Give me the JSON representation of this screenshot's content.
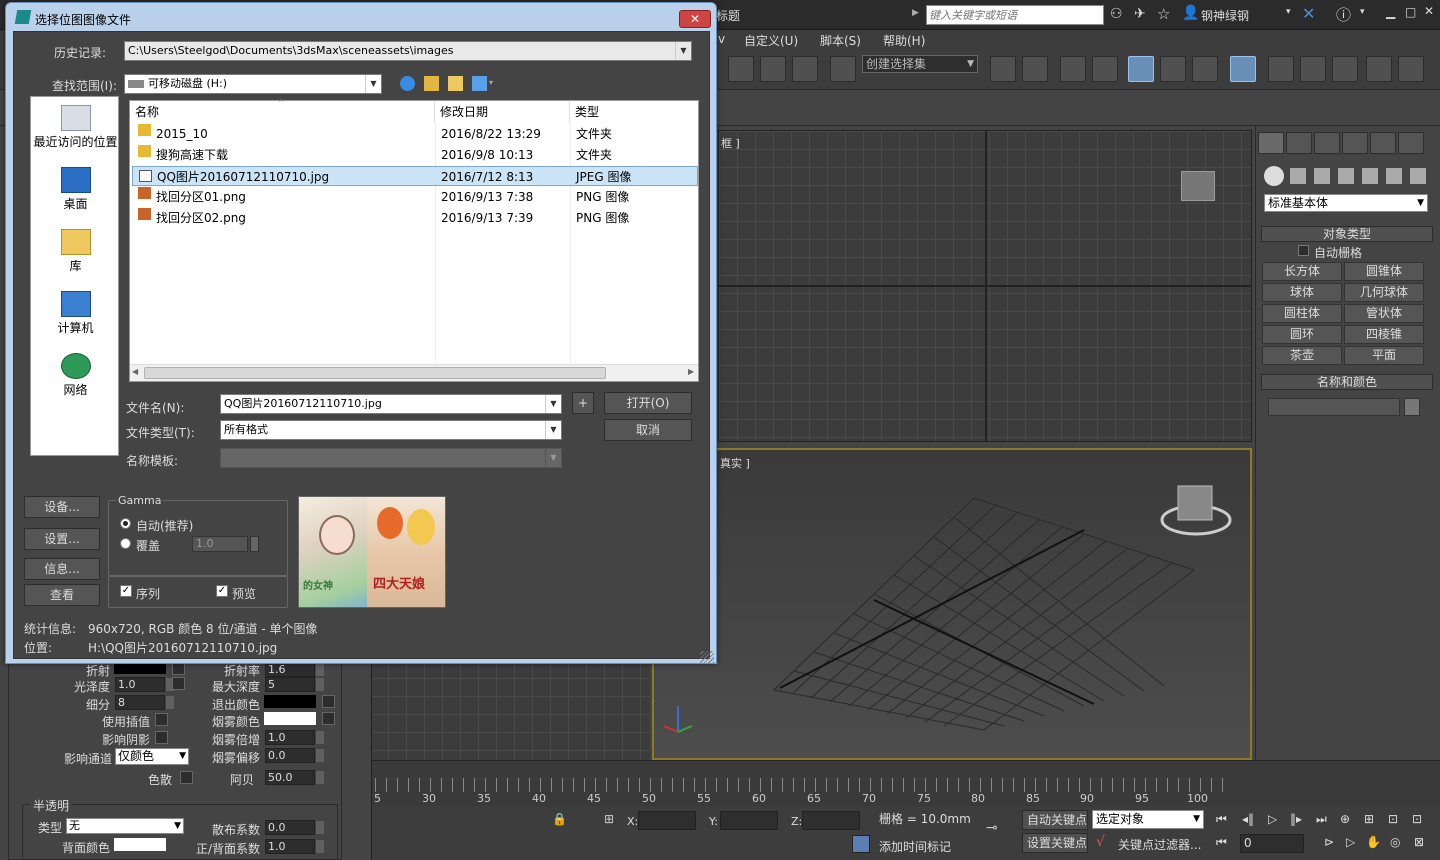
{
  "max": {
    "title_fragment": "标题",
    "search_placeholder": "键入关键字或短语",
    "user": "钢神绿钢",
    "menu": [
      "v",
      "自定义(U)",
      "脚本(S)",
      "帮助(H)"
    ],
    "selection_set": "创建选择集",
    "viewport_top_label": "框 ]",
    "viewport_persp_label": "真实 ]"
  },
  "command_panel": {
    "dropdown": "标准基本体",
    "object_type_header": "对象类型",
    "auto_grid": "自动栅格",
    "buttons": [
      "长方体",
      "圆锥体",
      "球体",
      "几何球体",
      "圆柱体",
      "管状体",
      "圆环",
      "四棱锥",
      "茶壶",
      "平面"
    ],
    "name_color_header": "名称和颜色"
  },
  "timeline": {
    "ticks": [
      "5",
      "30",
      "35",
      "40",
      "45",
      "50",
      "55",
      "60",
      "65",
      "70",
      "75",
      "80",
      "85",
      "90",
      "95",
      "100"
    ]
  },
  "status": {
    "x_label": "X:",
    "y_label": "Y:",
    "z_label": "Z:",
    "grid": "栅格 = 10.0mm",
    "auto_key": "自动关键点",
    "set_key": "设置关键点",
    "selected": "选定对象",
    "key_filter": "关键点过滤器...",
    "add_time_tag": "添加时间标记",
    "frame": "0"
  },
  "material_panel": {
    "refract_label": "折射",
    "refract_ior_label": "折射率",
    "refract_ior": "1.6",
    "gloss_label": "光泽度",
    "gloss": "1.0",
    "max_depth_label": "最大深度",
    "max_depth": "5",
    "subdiv_label": "细分",
    "subdiv": "8",
    "exit_color_label": "退出颜色",
    "use_interp_label": "使用插值",
    "fog_color_label": "烟雾颜色",
    "affect_shadow_label": "影响阴影",
    "fog_mult_label": "烟雾倍增",
    "fog_mult": "1.0",
    "fog_bias_label": "烟雾偏移",
    "fog_bias": "0.0",
    "affect_channel_label": "影响通道",
    "affect_channel": "仅颜色",
    "dispersion_label": "色散",
    "abbe_label": "阿贝",
    "abbe": "50.0",
    "translucency_header": "半透明",
    "type_label": "类型",
    "type_value": "无",
    "scatter_label": "散布系数",
    "scatter": "0.0",
    "back_color_label": "背面颜色",
    "fb_coef_label": "正/背面系数",
    "fb_coef": "1.0"
  },
  "dialog": {
    "title": "选择位图图像文件",
    "history_label": "历史记录:",
    "history_value": "C:\\Users\\Steelgod\\Documents\\3dsMax\\sceneassets\\images",
    "lookin_label": "查找范围(I):",
    "lookin_value": "可移动磁盘 (H:)",
    "places": [
      "最近访问的位置",
      "桌面",
      "库",
      "计算机",
      "网络"
    ],
    "columns": [
      "名称",
      "修改日期",
      "类型"
    ],
    "files": [
      {
        "name": "2015_10",
        "date": "2016/8/22 13:29",
        "type": "文件夹",
        "kind": "folder"
      },
      {
        "name": "搜狗高速下载",
        "date": "2016/9/8 10:13",
        "type": "文件夹",
        "kind": "folder"
      },
      {
        "name": "QQ图片20160712110710.jpg",
        "date": "2016/7/12 8:13",
        "type": "JPEG 图像",
        "kind": "jpg"
      },
      {
        "name": "找回分区01.png",
        "date": "2016/9/13 7:38",
        "type": "PNG 图像",
        "kind": "png"
      },
      {
        "name": "找回分区02.png",
        "date": "2016/9/13 7:39",
        "type": "PNG 图像",
        "kind": "png"
      }
    ],
    "selected_index": 2,
    "filename_label": "文件名(N):",
    "filename_value": "QQ图片20160712110710.jpg",
    "filetype_label": "文件类型(T):",
    "filetype_value": "所有格式",
    "template_label": "名称模板:",
    "plus_label": "+",
    "open_button": "打开(O)",
    "cancel_button": "取消",
    "setup_button": "设备...",
    "settings_button": "设置...",
    "info_button": "信息...",
    "view_button": "查看",
    "gamma_title": "Gamma",
    "gamma_auto": "自动(推荐)",
    "gamma_override": "覆盖",
    "gamma_value": "1.0",
    "sequence_label": "序列",
    "preview_label": "预览",
    "stats_label": "统计信息:",
    "stats_value": "960x720, RGB 颜色 8 位/通道 - 单个图像",
    "location_label": "位置:",
    "location_value": "H:\\QQ图片20160712110710.jpg",
    "thumb_text_left": "的女神",
    "thumb_text_right": "四大天娘"
  }
}
